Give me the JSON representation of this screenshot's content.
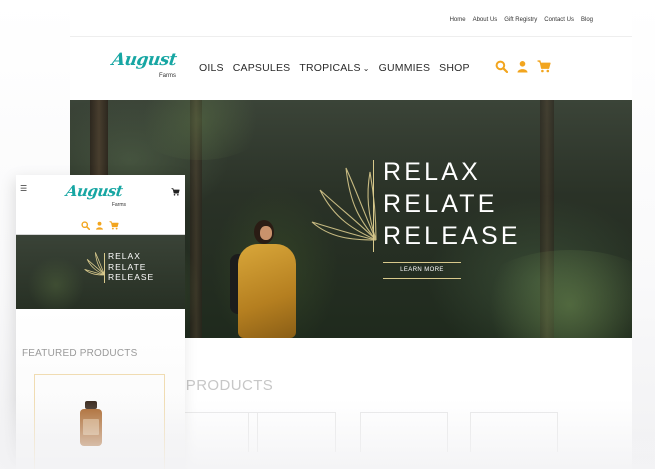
{
  "desktop": {
    "utility_nav": [
      "Home",
      "About Us",
      "Gift Registry",
      "Contact Us",
      "Blog"
    ],
    "logo": {
      "script": "August",
      "sub": "Farms"
    },
    "main_nav": [
      {
        "label": "OILS"
      },
      {
        "label": "CAPSULES"
      },
      {
        "label": "TROPICALS",
        "has_dropdown": true
      },
      {
        "label": "GUMMIES"
      },
      {
        "label": "SHOP"
      }
    ],
    "header_icons": [
      "search-icon",
      "user-icon",
      "cart-icon"
    ],
    "hero": {
      "line1": "RELAX",
      "line2": "RELATE",
      "line3": "RELEASE",
      "button_label": "LEARN MORE"
    },
    "featured_title": "D PRODUCTS"
  },
  "mobile": {
    "menu_icon": "hamburger-icon",
    "logo": {
      "script": "August",
      "sub": "Farms"
    },
    "header_icons": [
      "search-icon",
      "user-icon",
      "cart-icon"
    ],
    "hero": {
      "line1": "RELAX",
      "line2": "RELATE",
      "line3": "RELEASE"
    },
    "featured_title": "FEATURED PRODUCTS"
  },
  "colors": {
    "accent_orange": "#f2a51e",
    "brand_teal": "#17a6a3",
    "hero_gold": "#d8c98c"
  }
}
